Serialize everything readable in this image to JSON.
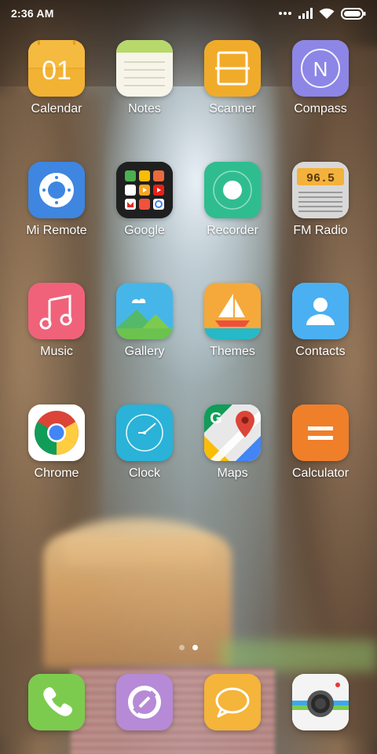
{
  "status_bar": {
    "time": "2:36 AM",
    "icons": [
      "more-dots-icon",
      "signal-icon",
      "wifi-icon",
      "battery-icon"
    ]
  },
  "apps": [
    {
      "label": "Calendar",
      "icon": "calendar-icon",
      "text": "01",
      "color": "#f2b233"
    },
    {
      "label": "Notes",
      "icon": "notes-icon",
      "color": "#f7f5ea"
    },
    {
      "label": "Scanner",
      "icon": "scanner-icon",
      "color": "#f1ab2a"
    },
    {
      "label": "Compass",
      "icon": "compass-icon",
      "text": "N",
      "color": "#8d86e6"
    },
    {
      "label": "Mi Remote",
      "icon": "remote-icon",
      "color": "#3e86e0"
    },
    {
      "label": "Google",
      "icon": "google-folder-icon",
      "color": "#1f1f1f"
    },
    {
      "label": "Recorder",
      "icon": "recorder-icon",
      "color": "#2fbd8f"
    },
    {
      "label": "FM Radio",
      "icon": "radio-icon",
      "text": "96.5",
      "color": "#c9c9c9"
    },
    {
      "label": "Music",
      "icon": "music-icon",
      "color": "#f0627a"
    },
    {
      "label": "Gallery",
      "icon": "gallery-icon",
      "color": "#46b6e8"
    },
    {
      "label": "Themes",
      "icon": "themes-icon",
      "color": "#f4a93a"
    },
    {
      "label": "Contacts",
      "icon": "contacts-icon",
      "color": "#4ab0f2"
    },
    {
      "label": "Chrome",
      "icon": "chrome-icon",
      "color": "#ffffff"
    },
    {
      "label": "Clock",
      "icon": "clock-icon",
      "color": "#2ab2d8"
    },
    {
      "label": "Maps",
      "icon": "maps-icon",
      "text": "G",
      "color": "#ffffff"
    },
    {
      "label": "Calculator",
      "icon": "calculator-icon",
      "color": "#f07f2a"
    }
  ],
  "page_indicator": {
    "count": 2,
    "active": 2
  },
  "dock": [
    {
      "icon": "phone-icon",
      "color": "#7ccb4f"
    },
    {
      "icon": "browser-icon",
      "color": "#b68ad6"
    },
    {
      "icon": "messaging-icon",
      "color": "#f5b43a"
    },
    {
      "icon": "camera-icon",
      "color": "#f4f4f4"
    }
  ]
}
